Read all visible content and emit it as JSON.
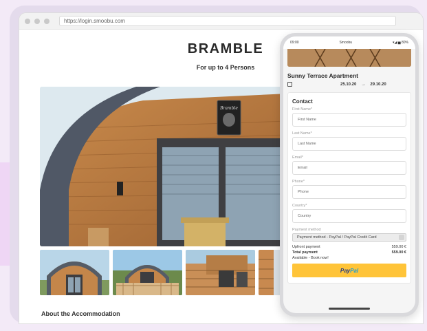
{
  "browser": {
    "url": "https://login.smoobu.com"
  },
  "page": {
    "title": "BRAMBLE",
    "subtitle": "For up to 4 Persons",
    "section_title": "About the Accommodation",
    "sign_text": "Bramble"
  },
  "phone": {
    "status": {
      "time": "09:00",
      "carrier": "Smoobu",
      "battery": "▾◢ ▅ 80%"
    },
    "apartment": {
      "name": "Sunny Terrace Apartment",
      "checkin": "25.10.20",
      "arrow": "→",
      "checkout": "29.10.20"
    },
    "contact": {
      "title": "Contact",
      "fields": [
        {
          "label": "First Name*",
          "placeholder": "First Name"
        },
        {
          "label": "Last Name*",
          "placeholder": "Last Name"
        },
        {
          "label": "Email*",
          "placeholder": "Email"
        },
        {
          "label": "Phone*",
          "placeholder": "Phone"
        },
        {
          "label": "Country*",
          "placeholder": "Country"
        }
      ],
      "payment_label": "Payment method",
      "payment_value": "Payment method - PayPal / PayPal Credit Card",
      "upfront_label": "Upfront payment",
      "upfront_value": "559.00 €",
      "total_label": "Total payment",
      "total_value": "559.00 €",
      "availability": "Available - Book now!",
      "paypal_pay": "Pay",
      "paypal_pal": "Pal"
    }
  },
  "colors": {
    "accent_bg": "#f3eaf7",
    "frame": "#e4dbec",
    "paypal_yellow": "#ffc439",
    "paypal_navy": "#253b80",
    "paypal_blue": "#179bd7"
  }
}
